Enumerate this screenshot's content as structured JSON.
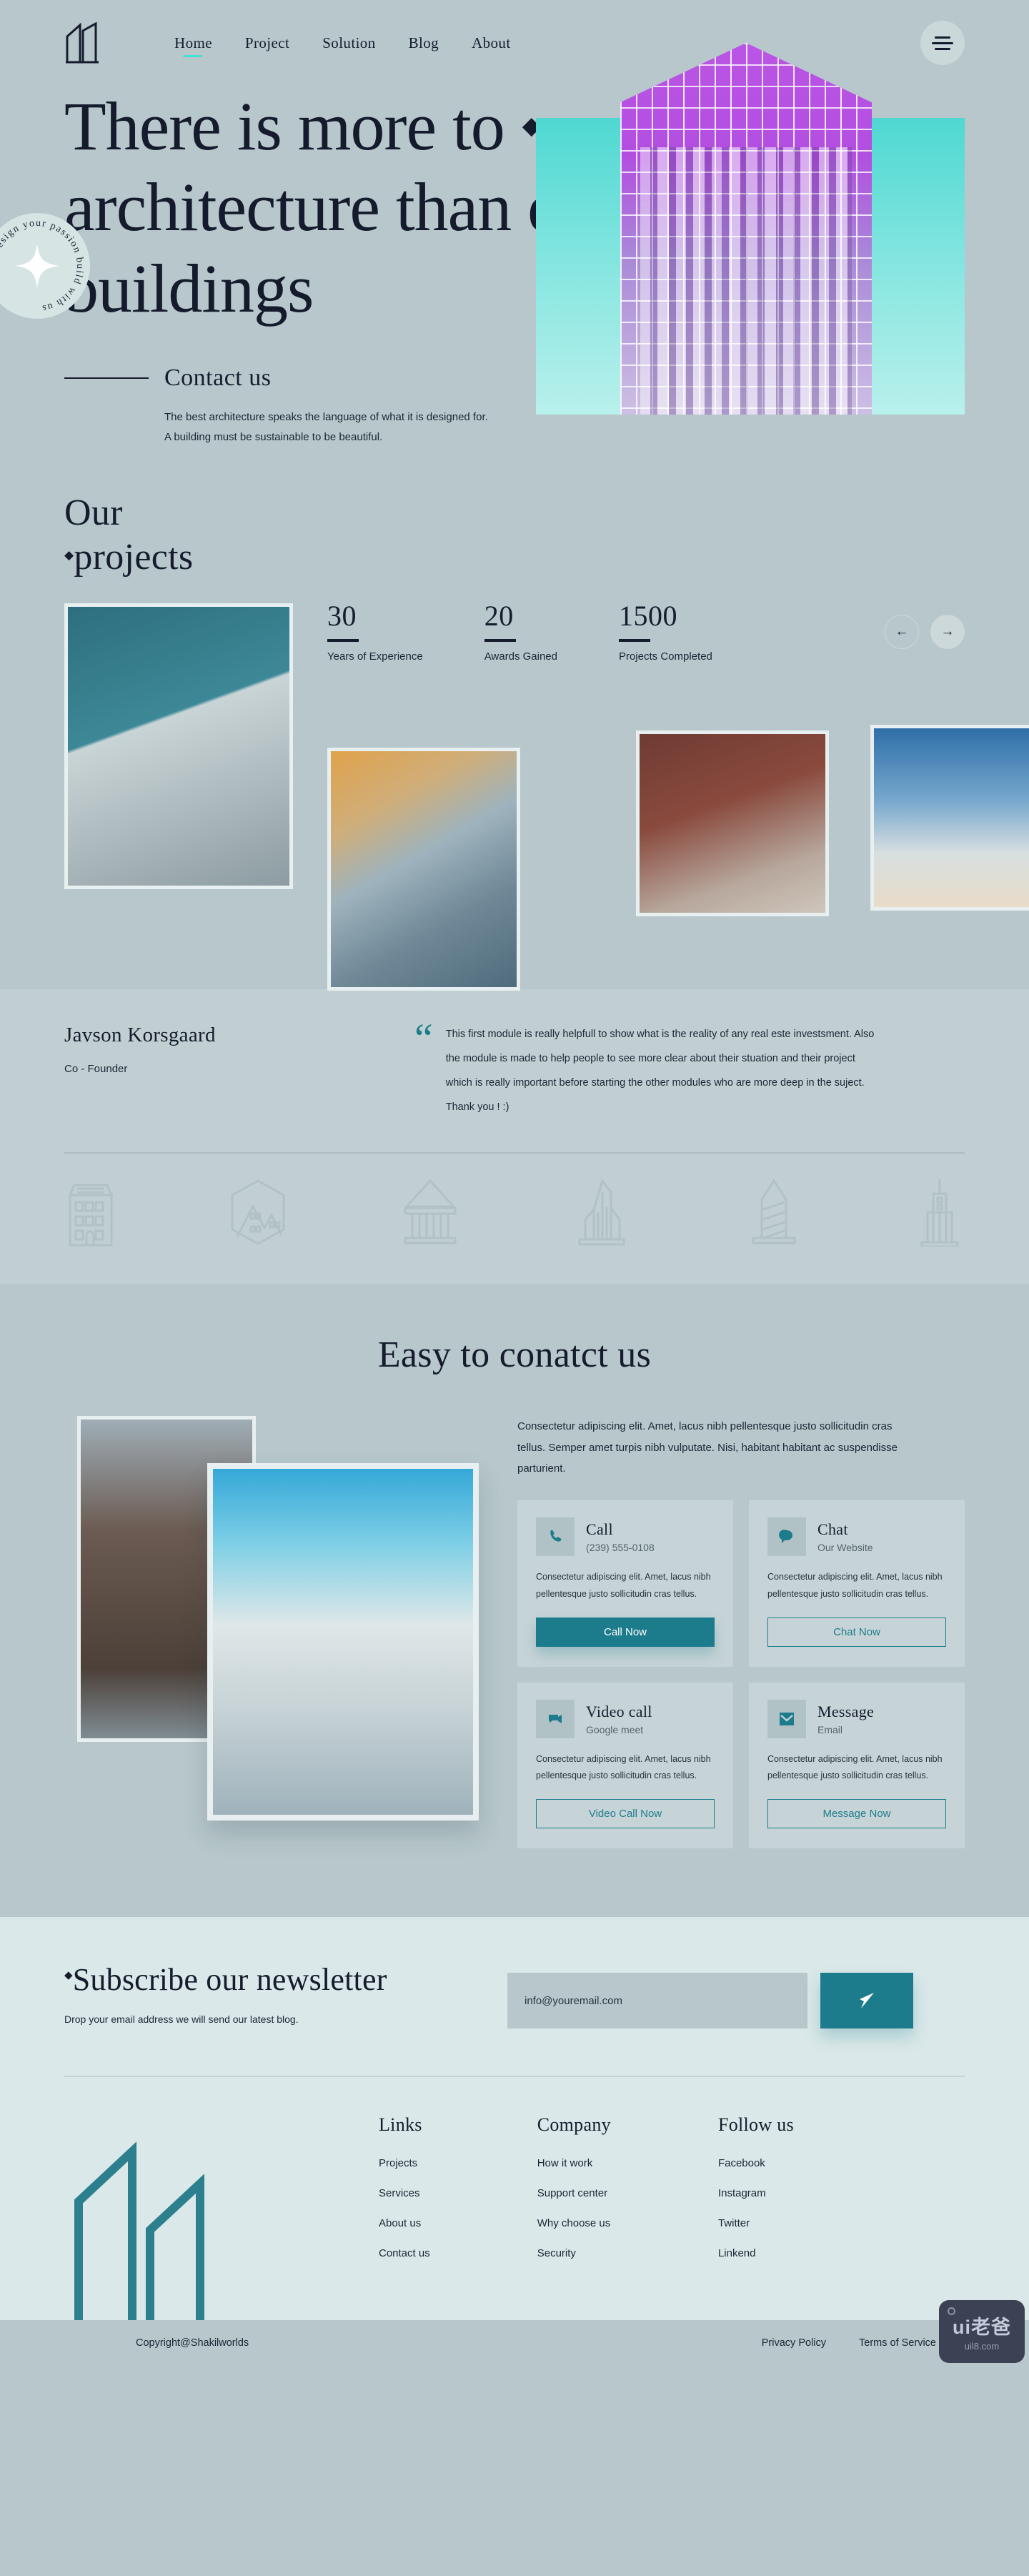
{
  "colors": {
    "bg": "#b7c7cb",
    "bg_band": "#c1cfd2",
    "footer_bg": "#dae8e9",
    "accent_teal": "#1d7c8c",
    "accent_cyan": "#46e0d2",
    "ink": "#161c2d"
  },
  "header": {
    "logo_name": "building-logo",
    "nav": [
      {
        "label": "Home",
        "active": true
      },
      {
        "label": "Project",
        "active": false
      },
      {
        "label": "Solution",
        "active": false
      },
      {
        "label": "Blog",
        "active": false
      },
      {
        "label": "About",
        "active": false
      }
    ],
    "menu_icon": "hamburger-icon"
  },
  "hero": {
    "title_line1": "There is more to",
    "title_line2": "architecture than designing",
    "title_line3": "buildings",
    "badge_text": "Design your passion build with us",
    "badge_icon": "four-point-star-icon",
    "contact": {
      "heading": "Contact us",
      "body": "The best architecture speaks the language of what it is designed for. A building must be sustainable to be beautiful."
    }
  },
  "projects": {
    "heading_line1": "Our",
    "heading_line2": "projects",
    "stats": [
      {
        "number": "30",
        "label": "Years of Experience"
      },
      {
        "number": "20",
        "label": "Awards Gained"
      },
      {
        "number": "1500",
        "label": "Projects Completed"
      }
    ],
    "prev_icon": "arrow-left-icon",
    "next_icon": "arrow-right-icon",
    "photos": [
      {
        "name": "project-photo-1"
      },
      {
        "name": "project-photo-2"
      },
      {
        "name": "project-photo-3"
      },
      {
        "name": "project-photo-4"
      }
    ]
  },
  "testimonial": {
    "name": "Javson Korsgaard",
    "role": "Co - Founder",
    "quote_icon": "quote-mark-icon",
    "quote": "This first module is really helpfull to show what is the reality of any real este investsment. Also the module is made to help people to see more clear about their stuation and their project which is really important before starting the other modules who are more deep in the suject. Thank you ! :)",
    "logos": [
      "apartment-building-icon",
      "hexagon-mountain-icon",
      "classical-temple-icon",
      "skyscraper-icon",
      "obelisk-tower-icon",
      "spire-tower-icon"
    ]
  },
  "easy_contact": {
    "heading": "Easy to conatct us",
    "photo_left": "chicago-tower-photo",
    "photo_right": "aqua-tower-photo",
    "lead": "Consectetur adipiscing elit. Amet, lacus nibh pellentesque justo sollicitudin cras tellus. Semper amet turpis nibh vulputate. Nisi, habitant habitant ac suspendisse parturient.",
    "cards": [
      {
        "icon": "phone-icon",
        "title": "Call",
        "subtitle": "(239) 555-0108",
        "body": "Consectetur adipiscing elit. Amet, lacus nibh pellentesque justo sollicitudin cras tellus.",
        "button": "Call Now",
        "solid": true
      },
      {
        "icon": "chat-bubble-icon",
        "title": "Chat",
        "subtitle": "Our Website",
        "body": "Consectetur adipiscing elit. Amet, lacus nibh pellentesque justo sollicitudin cras tellus.",
        "button": "Chat Now",
        "solid": false
      },
      {
        "icon": "video-camera-icon",
        "title": "Video call",
        "subtitle": "Google meet",
        "body": "Consectetur adipiscing elit. Amet, lacus nibh pellentesque justo sollicitudin cras tellus.",
        "button": "Video Call Now",
        "solid": false
      },
      {
        "icon": "envelope-icon",
        "title": "Message",
        "subtitle": "Email",
        "body": "Consectetur adipiscing elit. Amet, lacus nibh pellentesque justo sollicitudin cras tellus.",
        "button": "Message Now",
        "solid": false
      }
    ]
  },
  "newsletter": {
    "heading": "Subscribe our newsletter",
    "sub": "Drop your email address we will send our latest blog.",
    "placeholder": "info@youremail.com",
    "value": "",
    "send_icon": "paper-plane-icon"
  },
  "footer": {
    "columns": [
      {
        "title": "Links",
        "items": [
          "Projects",
          "Services",
          "About us",
          "Contact us"
        ]
      },
      {
        "title": "Company",
        "items": [
          "How it work",
          "Support center",
          "Why choose us",
          "Security"
        ]
      },
      {
        "title": "Follow us",
        "items": [
          "Facebook",
          "Instagram",
          "Twitter",
          "Linkend"
        ]
      }
    ],
    "copyright": "Copyright@Shakilworlds",
    "legal": [
      "Privacy Policy",
      "Terms of Service"
    ]
  },
  "watermark": {
    "main": "ui老爸",
    "sub": "uil8.com"
  }
}
